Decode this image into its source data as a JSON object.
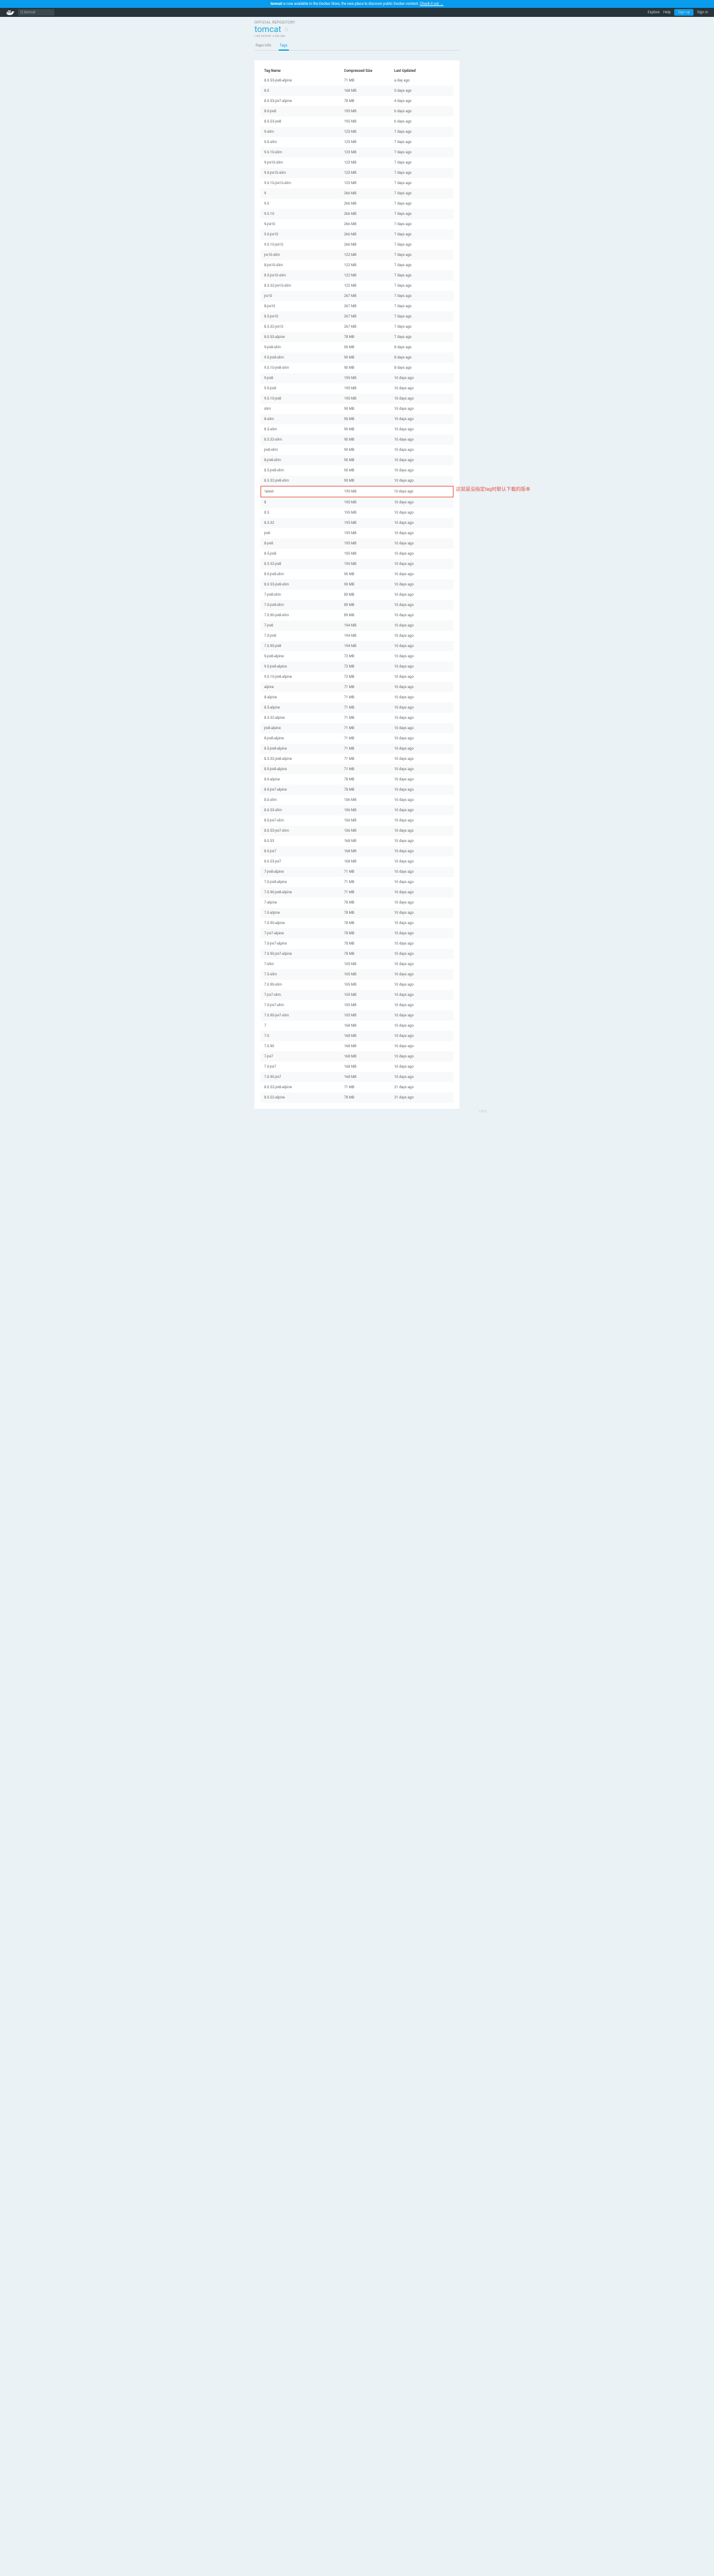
{
  "banner": {
    "text_prefix": "tomcat",
    "text": " is now available in the Docker Store, the new place to discover public Docker content. ",
    "link": "Check it out →"
  },
  "nav": {
    "search_placeholder": "Q tomcat",
    "explore": "Explore",
    "help": "Help",
    "signup": "Sign up",
    "signin": "Sign in"
  },
  "header": {
    "official": "OFFICIAL REPOSITORY",
    "title": "tomcat",
    "pushed": "Last pushed: a day ago"
  },
  "tabs": {
    "info": "Repo Info",
    "tags": "Tags"
  },
  "columns": {
    "name": "Tag Name",
    "size": "Compressed Size",
    "updated": "Last Updated"
  },
  "annotation": "这就是没指定tag时默认下载的版本",
  "highlight_tag": "latest",
  "rows": [
    {
      "n": "8.0.53-jre8-alpine",
      "s": "71 MB",
      "u": "a day ago"
    },
    {
      "n": "8.0",
      "s": "168 MB",
      "u": "5 days ago"
    },
    {
      "n": "8.0.53-jre7-alpine",
      "s": "78 MB",
      "u": "4 days ago"
    },
    {
      "n": "8.0-jre8",
      "s": "195 MB",
      "u": "6 days ago"
    },
    {
      "n": "8.0.53-jre8",
      "s": "195 MB",
      "u": "6 days ago"
    },
    {
      "n": "9-slim",
      "s": "123 MB",
      "u": "7 days ago"
    },
    {
      "n": "9.0-slim",
      "s": "123 MB",
      "u": "7 days ago"
    },
    {
      "n": "9.0.10-slim",
      "s": "123 MB",
      "u": "7 days ago"
    },
    {
      "n": "9-jre10-slim",
      "s": "123 MB",
      "u": "7 days ago"
    },
    {
      "n": "9.0-jre10-slim",
      "s": "123 MB",
      "u": "7 days ago"
    },
    {
      "n": "9.0.10-jre10-slim",
      "s": "123 MB",
      "u": "7 days ago"
    },
    {
      "n": "9",
      "s": "266 MB",
      "u": "7 days ago"
    },
    {
      "n": "9.0",
      "s": "266 MB",
      "u": "7 days ago"
    },
    {
      "n": "9.0.10",
      "s": "266 MB",
      "u": "7 days ago"
    },
    {
      "n": "9-jre10",
      "s": "266 MB",
      "u": "7 days ago"
    },
    {
      "n": "9.0-jre10",
      "s": "266 MB",
      "u": "7 days ago"
    },
    {
      "n": "9.0.10-jre10",
      "s": "266 MB",
      "u": "7 days ago"
    },
    {
      "n": "jre10-slim",
      "s": "122 MB",
      "u": "7 days ago"
    },
    {
      "n": "8-jre10-slim",
      "s": "122 MB",
      "u": "7 days ago"
    },
    {
      "n": "8.5-jre10-slim",
      "s": "122 MB",
      "u": "7 days ago"
    },
    {
      "n": "8.5.32-jre10-slim",
      "s": "122 MB",
      "u": "7 days ago"
    },
    {
      "n": "jre10",
      "s": "267 MB",
      "u": "7 days ago"
    },
    {
      "n": "8-jre10",
      "s": "267 MB",
      "u": "7 days ago"
    },
    {
      "n": "8.5-jre10",
      "s": "267 MB",
      "u": "7 days ago"
    },
    {
      "n": "8.5.32-jre10",
      "s": "267 MB",
      "u": "7 days ago"
    },
    {
      "n": "8.0.53-alpine",
      "s": "78 MB",
      "u": "7 days ago"
    },
    {
      "n": "9-jre8-slim",
      "s": "90 MB",
      "u": "8 days ago"
    },
    {
      "n": "9.0-jre8-slim",
      "s": "90 MB",
      "u": "8 days ago"
    },
    {
      "n": "9.0.10-jre8-slim",
      "s": "90 MB",
      "u": "8 days ago"
    },
    {
      "n": "9-jre8",
      "s": "195 MB",
      "u": "10 days ago"
    },
    {
      "n": "9.0-jre8",
      "s": "195 MB",
      "u": "10 days ago"
    },
    {
      "n": "9.0.10-jre8",
      "s": "195 MB",
      "u": "10 days ago"
    },
    {
      "n": "slim",
      "s": "90 MB",
      "u": "10 days ago"
    },
    {
      "n": "8-slim",
      "s": "90 MB",
      "u": "10 days ago"
    },
    {
      "n": "8.5-slim",
      "s": "90 MB",
      "u": "10 days ago"
    },
    {
      "n": "8.5.32-slim",
      "s": "90 MB",
      "u": "10 days ago"
    },
    {
      "n": "jre8-slim",
      "s": "90 MB",
      "u": "10 days ago"
    },
    {
      "n": "8-jre8-slim",
      "s": "90 MB",
      "u": "10 days ago"
    },
    {
      "n": "8.5-jre8-slim",
      "s": "90 MB",
      "u": "10 days ago"
    },
    {
      "n": "8.5.32-jre8-slim",
      "s": "90 MB",
      "u": "10 days ago"
    },
    {
      "n": "latest",
      "s": "195 MB",
      "u": "10 days ago"
    },
    {
      "n": "8",
      "s": "195 MB",
      "u": "10 days ago"
    },
    {
      "n": "8.5",
      "s": "195 MB",
      "u": "10 days ago"
    },
    {
      "n": "8.5.32",
      "s": "195 MB",
      "u": "10 days ago"
    },
    {
      "n": "jre8",
      "s": "195 MB",
      "u": "10 days ago"
    },
    {
      "n": "8-jre8",
      "s": "195 MB",
      "u": "10 days ago"
    },
    {
      "n": "8.5-jre8",
      "s": "195 MB",
      "u": "10 days ago"
    },
    {
      "n": "8.5.32-jre8",
      "s": "195 MB",
      "u": "10 days ago"
    },
    {
      "n": "8.0-jre8-slim",
      "s": "90 MB",
      "u": "10 days ago"
    },
    {
      "n": "8.0.53-jre8-slim",
      "s": "90 MB",
      "u": "10 days ago"
    },
    {
      "n": "7-jre8-slim",
      "s": "89 MB",
      "u": "10 days ago"
    },
    {
      "n": "7.0-jre8-slim",
      "s": "89 MB",
      "u": "10 days ago"
    },
    {
      "n": "7.0.90-jre8-slim",
      "s": "89 MB",
      "u": "10 days ago"
    },
    {
      "n": "7-jre8",
      "s": "194 MB",
      "u": "10 days ago"
    },
    {
      "n": "7.0-jre8",
      "s": "194 MB",
      "u": "10 days ago"
    },
    {
      "n": "7.0.90-jre8",
      "s": "194 MB",
      "u": "10 days ago"
    },
    {
      "n": "9-jre8-alpine",
      "s": "72 MB",
      "u": "10 days ago"
    },
    {
      "n": "9.0-jre8-alpine",
      "s": "72 MB",
      "u": "10 days ago"
    },
    {
      "n": "9.0.10-jre8-alpine",
      "s": "72 MB",
      "u": "10 days ago"
    },
    {
      "n": "alpine",
      "s": "71 MB",
      "u": "10 days ago"
    },
    {
      "n": "8-alpine",
      "s": "71 MB",
      "u": "10 days ago"
    },
    {
      "n": "8.5-alpine",
      "s": "71 MB",
      "u": "10 days ago"
    },
    {
      "n": "8.5.32-alpine",
      "s": "71 MB",
      "u": "10 days ago"
    },
    {
      "n": "jre8-alpine",
      "s": "71 MB",
      "u": "10 days ago"
    },
    {
      "n": "8-jre8-alpine",
      "s": "71 MB",
      "u": "10 days ago"
    },
    {
      "n": "8.5-jre8-alpine",
      "s": "71 MB",
      "u": "10 days ago"
    },
    {
      "n": "8.5.32-jre8-alpine",
      "s": "71 MB",
      "u": "10 days ago"
    },
    {
      "n": "8.0-jre8-alpine",
      "s": "71 MB",
      "u": "10 days ago"
    },
    {
      "n": "8.0-alpine",
      "s": "78 MB",
      "u": "10 days ago"
    },
    {
      "n": "8.0-jre7-alpine",
      "s": "78 MB",
      "u": "10 days ago"
    },
    {
      "n": "8.0-slim",
      "s": "106 MB",
      "u": "10 days ago"
    },
    {
      "n": "8.0.53-slim",
      "s": "106 MB",
      "u": "10 days ago"
    },
    {
      "n": "8.0-jre7-slim",
      "s": "106 MB",
      "u": "10 days ago"
    },
    {
      "n": "8.0.53-jre7-slim",
      "s": "106 MB",
      "u": "10 days ago"
    },
    {
      "n": "8.0.53",
      "s": "168 MB",
      "u": "10 days ago"
    },
    {
      "n": "8.0-jre7",
      "s": "168 MB",
      "u": "10 days ago"
    },
    {
      "n": "8.0.53-jre7",
      "s": "168 MB",
      "u": "10 days ago"
    },
    {
      "n": "7-jre8-alpine",
      "s": "71 MB",
      "u": "10 days ago"
    },
    {
      "n": "7.0-jre8-alpine",
      "s": "71 MB",
      "u": "10 days ago"
    },
    {
      "n": "7.0.90-jre8-alpine",
      "s": "71 MB",
      "u": "10 days ago"
    },
    {
      "n": "7-alpine",
      "s": "78 MB",
      "u": "10 days ago"
    },
    {
      "n": "7.0-alpine",
      "s": "78 MB",
      "u": "10 days ago"
    },
    {
      "n": "7.0.90-alpine",
      "s": "78 MB",
      "u": "10 days ago"
    },
    {
      "n": "7-jre7-alpine",
      "s": "78 MB",
      "u": "10 days ago"
    },
    {
      "n": "7.0-jre7-alpine",
      "s": "78 MB",
      "u": "10 days ago"
    },
    {
      "n": "7.0.90-jre7-alpine",
      "s": "78 MB",
      "u": "10 days ago"
    },
    {
      "n": "7-slim",
      "s": "105 MB",
      "u": "10 days ago"
    },
    {
      "n": "7.0-slim",
      "s": "105 MB",
      "u": "10 days ago"
    },
    {
      "n": "7.0.90-slim",
      "s": "105 MB",
      "u": "10 days ago"
    },
    {
      "n": "7-jre7-slim",
      "s": "105 MB",
      "u": "10 days ago"
    },
    {
      "n": "7.0-jre7-slim",
      "s": "105 MB",
      "u": "10 days ago"
    },
    {
      "n": "7.0.90-jre7-slim",
      "s": "105 MB",
      "u": "10 days ago"
    },
    {
      "n": "7",
      "s": "168 MB",
      "u": "10 days ago"
    },
    {
      "n": "7.0",
      "s": "168 MB",
      "u": "10 days ago"
    },
    {
      "n": "7.0.90",
      "s": "168 MB",
      "u": "10 days ago"
    },
    {
      "n": "7-jre7",
      "s": "168 MB",
      "u": "10 days ago"
    },
    {
      "n": "7.0-jre7",
      "s": "168 MB",
      "u": "10 days ago"
    },
    {
      "n": "7.0.90-jre7",
      "s": "168 MB",
      "u": "10 days ago"
    },
    {
      "n": "8.0.52-jre8-alpine",
      "s": "71 MB",
      "u": "21 days ago"
    },
    {
      "n": "8.0.52-alpine",
      "s": "78 MB",
      "u": "21 days ago"
    }
  ]
}
